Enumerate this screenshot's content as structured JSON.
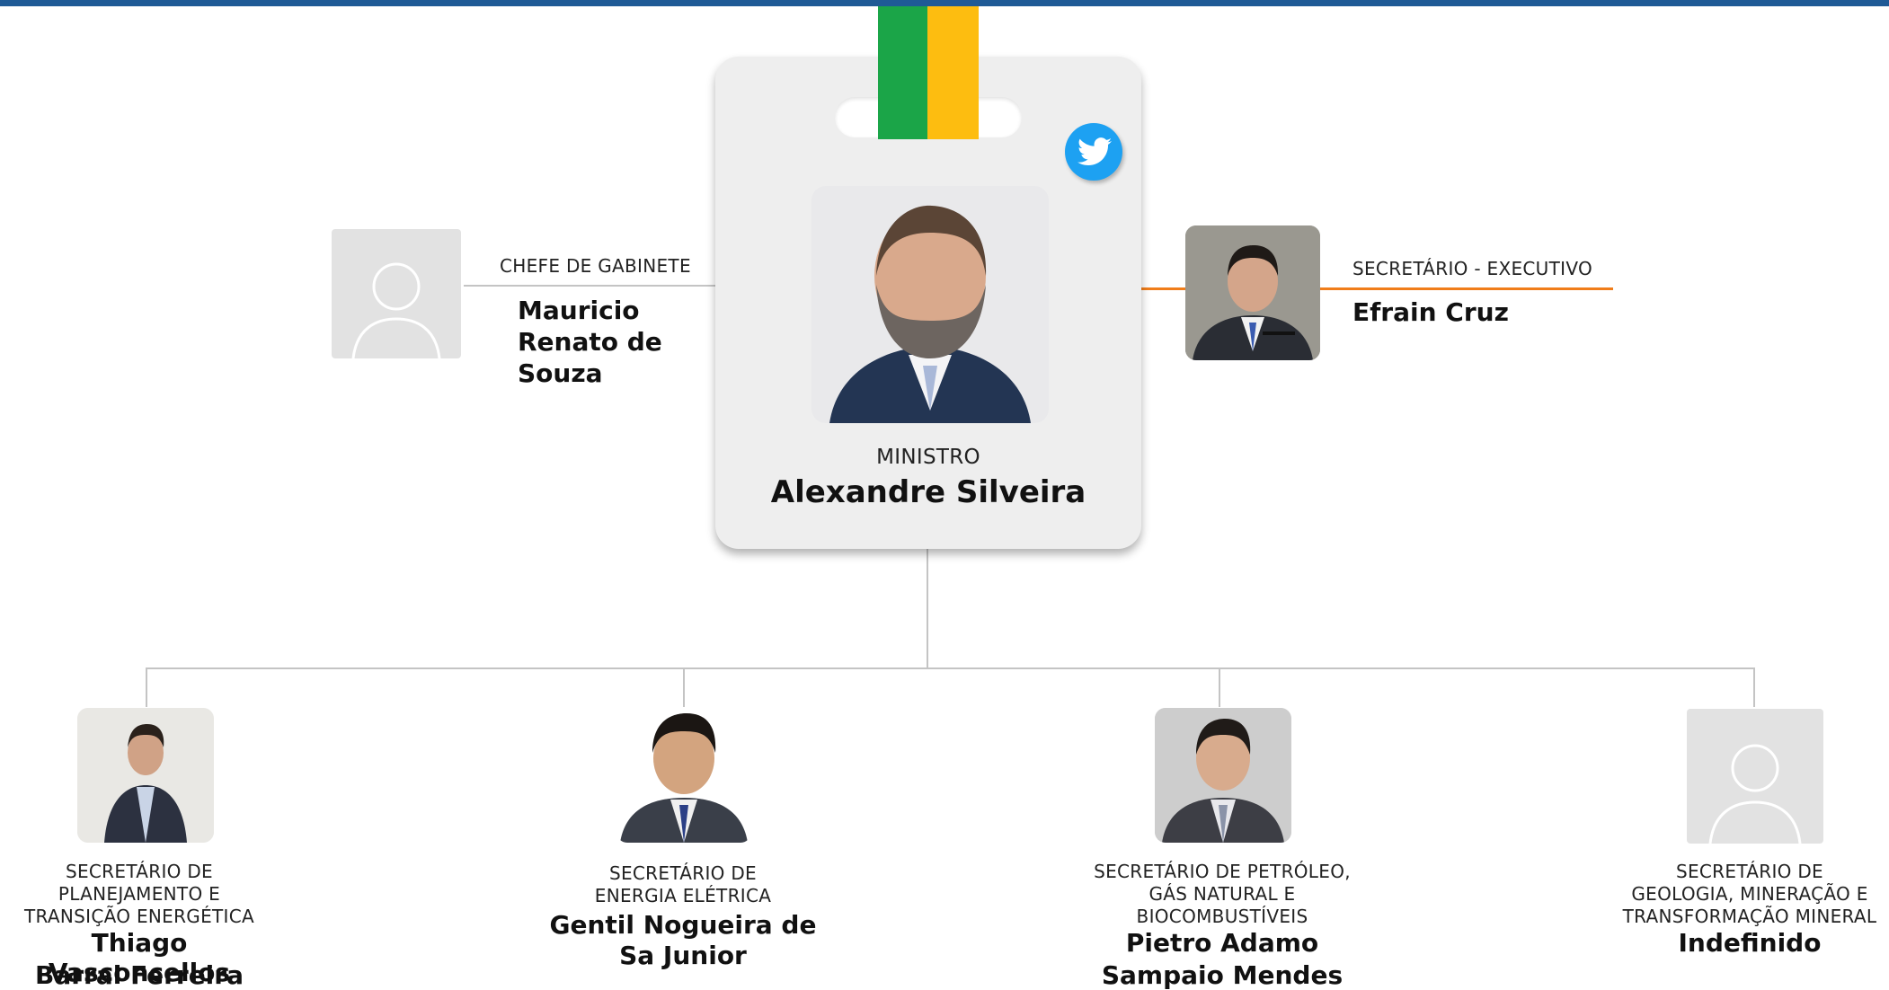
{
  "minister": {
    "role": "MINISTRO",
    "name": "Alexandre Silveira",
    "social_icon": "twitter-icon",
    "strap_colors": [
      "#1ba548",
      "#fdbd10"
    ]
  },
  "left_aide": {
    "role": "CHEFE DE GABINETE",
    "name_lines": [
      "Mauricio",
      "Renato de",
      "Souza"
    ],
    "photo": "placeholder-avatar-icon"
  },
  "right_aide": {
    "role": "SECRETÁRIO - EXECUTIVO",
    "name": "Efrain Cruz",
    "accent": "#f07d1a"
  },
  "secretaries": [
    {
      "role_lines": [
        "SECRETÁRIO DE",
        "PLANEJAMENTO E",
        "TRANSIÇÃO ENERGÉTICA"
      ],
      "name_lines": [
        "Thiago Vasconcellos",
        "Barral Ferreira"
      ]
    },
    {
      "role_lines": [
        "SECRETÁRIO DE",
        "ENERGIA ELÉTRICA"
      ],
      "name_lines": [
        "Gentil Nogueira de",
        "Sa Junior"
      ]
    },
    {
      "role_lines": [
        "SECRETÁRIO DE PETRÓLEO,",
        "GÁS NATURAL E",
        "BIOCOMBUSTÍVEIS"
      ],
      "name_lines": [
        "Pietro Adamo",
        "Sampaio Mendes"
      ]
    },
    {
      "role_lines": [
        "SECRETÁRIO DE",
        "GEOLOGIA, MINERAÇÃO E",
        "TRANSFORMAÇÃO MINERAL"
      ],
      "name_lines": [
        "Indefinido"
      ],
      "photo": "placeholder-avatar-icon"
    }
  ],
  "colors": {
    "top_bar": "#1f5a96",
    "connector": "#c4c4c4"
  }
}
